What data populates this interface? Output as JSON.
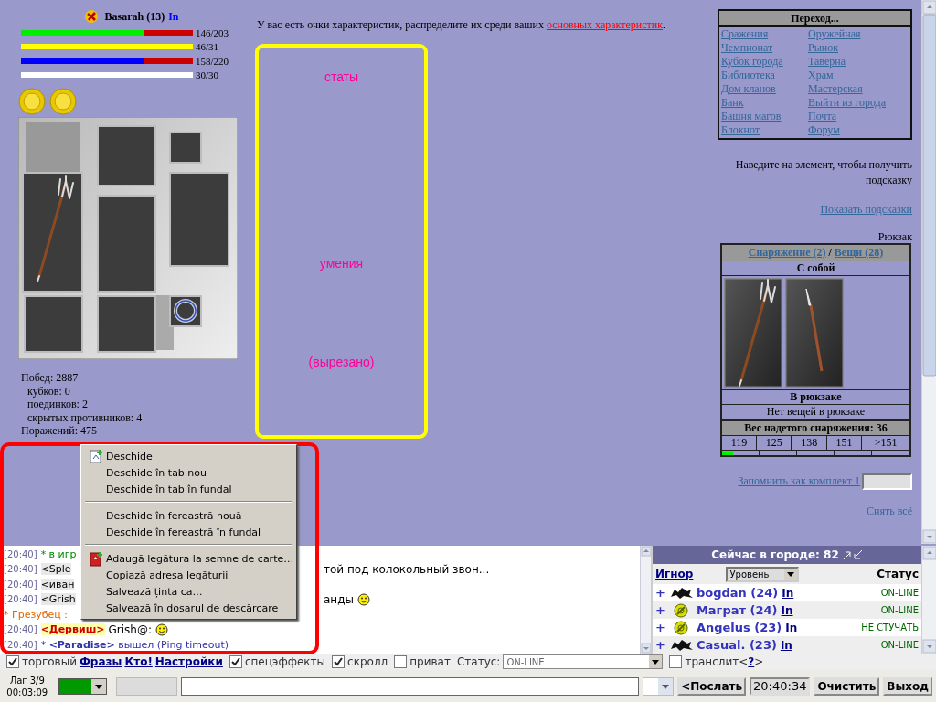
{
  "character": {
    "name": "Basarah (13)",
    "info_link": "In",
    "bars": [
      {
        "color": "#00ee00",
        "level": 0.72,
        "reading": "146/203"
      },
      {
        "color": "#ffff00",
        "level": 1,
        "reading": "46/31"
      },
      {
        "color": "#0000ff",
        "level": 0.72,
        "reading": "158/220"
      },
      {
        "color": "#ffffff",
        "level": 1,
        "reading": "30/30"
      }
    ],
    "stats": [
      {
        "text": "Побед: 2887",
        "children": [
          {
            "text": "кубков: 0"
          },
          {
            "text": "поединков: 2"
          },
          {
            "text": "скрытых противников: 4"
          }
        ]
      },
      {
        "text": "Поражений: 475"
      }
    ]
  },
  "notice": {
    "text": "У вас есть очки характеристик, распределите их среди ваших ",
    "link": "основных характеристик",
    "after": "."
  },
  "frame_labels": [
    "статы",
    "умения",
    "(вырезано)"
  ],
  "navigation": {
    "title": "Переход...",
    "links": [
      "Сражения",
      "Оружейная",
      "Чемпионат",
      "Рынок",
      "Кубок города",
      "Таверна",
      "Библиотека",
      "Храм",
      "Дом кланов",
      "Мастерская",
      "Банк",
      "Выйти из города",
      "Башня магов",
      "Почта",
      "Блокнот",
      "Форум"
    ]
  },
  "hint": "Наведите на элемент, чтобы получить подсказку",
  "show_hints_link": "Показать подсказки",
  "backpack_title": "Рюкзак",
  "inventory": {
    "equipment_link": "Снаряжение (2)",
    "separator": "/",
    "things_link": "Вещи (28)",
    "carried_title": "С собой",
    "backpack_title": "В рюкзаке",
    "backpack_empty": "Нет вещей в рюкзаке",
    "weight_title": "Вес надетого снаряжения: 36",
    "weights": [
      "119",
      "125",
      "138",
      "151",
      ">151"
    ],
    "level": 0.06
  },
  "remember_link": "Запомнить как комплект 1",
  "remove_all_link": "Снять всё",
  "chat": [
    {
      "kind": "system",
      "time": "[20:40]",
      "text": "* в игр"
    },
    {
      "kind": "message",
      "time": "[20:40]",
      "nick": "<Sple",
      "tail": "той под колокольный звон..."
    },
    {
      "kind": "message",
      "time": "[20:40]",
      "nick": "<иван"
    },
    {
      "kind": "message",
      "time": "[20:40]",
      "nick": "<Grish",
      "tail": "анды",
      "smiley": true
    },
    {
      "kind": "event",
      "text": "* Грезубец : "
    },
    {
      "kind": "address",
      "time": "[20:40]",
      "nick": "<Дервиш>",
      "text": "Grish@:",
      "smiley": true
    },
    {
      "kind": "exit",
      "time": "[20:40]",
      "text": "* ",
      "nick": "<Paradise>",
      "tail": "вышел (Ping timeout)"
    }
  ],
  "online": {
    "title": "Сейчас в городе: 82",
    "ignore_link": "Игнор",
    "sort": "Уровень",
    "status_header": "Статус",
    "users": [
      {
        "toggle": "+",
        "kind": "dragon",
        "name": "bogdan (24)",
        "info": "In",
        "status": "ON-LINE"
      },
      {
        "toggle": "+",
        "kind": "coin",
        "name": "Маграт (24)",
        "info": "In",
        "status": "ON-LINE"
      },
      {
        "toggle": "+",
        "kind": "coin",
        "name": "Angelus (23)",
        "info": "In",
        "status": "НЕ СТУЧАТЬ"
      },
      {
        "toggle": "+",
        "kind": "dragon",
        "name": "Casual. (23)",
        "info": "In",
        "status": "ON-LINE"
      }
    ]
  },
  "options": [
    {
      "kind": "check",
      "label": "торговый",
      "checked": true
    },
    {
      "kind": "link",
      "label": "Фразы"
    },
    {
      "kind": "link",
      "label": "Кто!"
    },
    {
      "kind": "link",
      "label": "Настройки"
    },
    {
      "kind": "check",
      "label": "спецэффекты",
      "checked": true
    },
    {
      "kind": "check",
      "label": "скролл",
      "checked": true
    },
    {
      "kind": "check",
      "label": "приват",
      "checked": false
    },
    {
      "kind": "select",
      "label": "Статус:",
      "value": "ON-LINE"
    },
    {
      "kind": "check",
      "label": "транслит",
      "checked": false
    },
    {
      "kind": "help",
      "before": "<",
      "link": "?",
      "after": ">"
    }
  ],
  "bottom": {
    "lag": "Лаг 3/9",
    "timer": "00:03:09",
    "send": "<Послать",
    "time": "20:40:34",
    "clear": "Очистить",
    "exit": "Выход"
  },
  "context_menu": [
    {
      "kind": "page",
      "label": "Deschide"
    },
    {
      "kind": "item",
      "label": "Deschide în tab nou"
    },
    {
      "kind": "item",
      "label": "Deschide în tab în fundal"
    },
    {
      "kind": "separator"
    },
    {
      "kind": "item",
      "label": "Deschide în fereastră nouă"
    },
    {
      "kind": "item",
      "label": "Deschide în fereastră în fundal"
    },
    {
      "kind": "separator"
    },
    {
      "kind": "bookmark",
      "label": "Adaugă legătura la semne de carte…"
    },
    {
      "kind": "item",
      "label": "Copiază adresa legăturii"
    },
    {
      "kind": "item",
      "label": "Salvează ținta ca…"
    },
    {
      "kind": "item",
      "label": "Salvează în dosarul de descărcare"
    }
  ]
}
